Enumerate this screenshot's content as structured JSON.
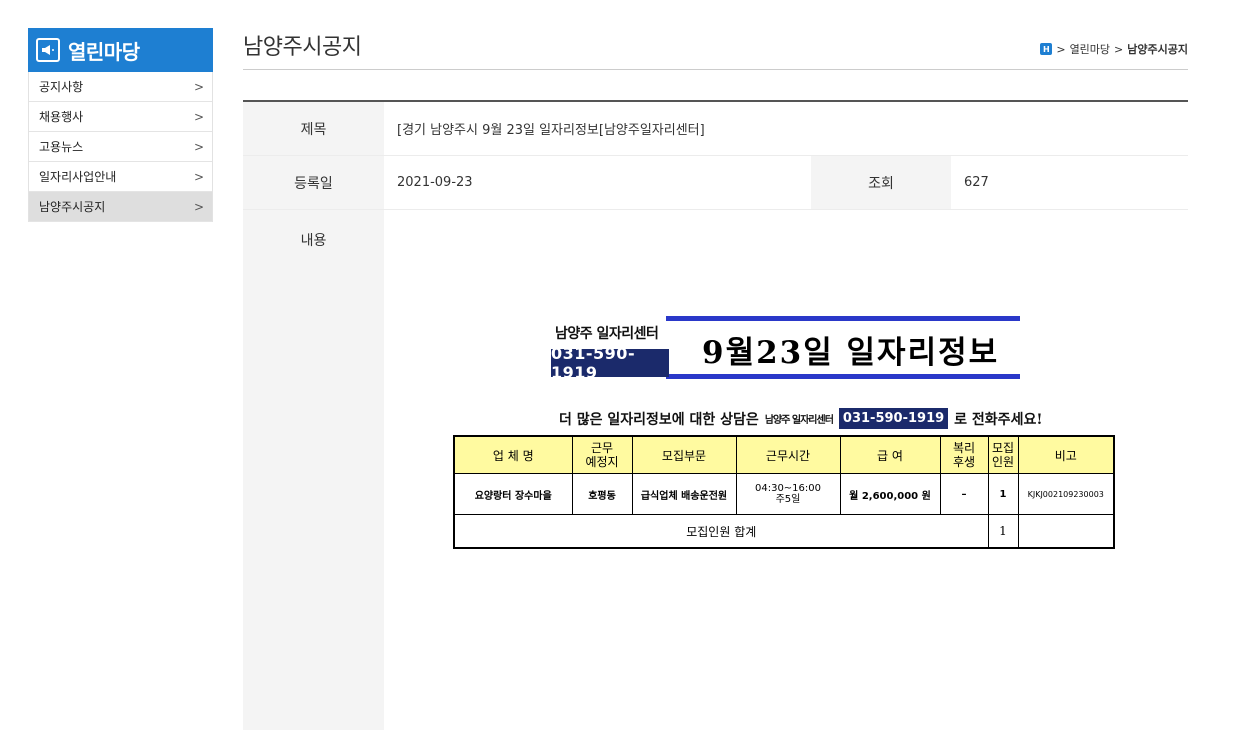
{
  "sidebar": {
    "title": "열린마당",
    "items": [
      {
        "label": "공지사항",
        "active": false
      },
      {
        "label": "채용행사",
        "active": false
      },
      {
        "label": "고용뉴스",
        "active": false
      },
      {
        "label": "일자리사업안내",
        "active": false
      },
      {
        "label": "남양주시공지",
        "active": true
      }
    ]
  },
  "header": {
    "title": "남양주시공지",
    "breadcrumb": [
      "열린마당",
      "남양주시공지"
    ]
  },
  "detail": {
    "subject_label": "제목",
    "subject": "[경기 남양주시 9월 23일 일자리정보[남양주일자리센터]",
    "date_label": "등록일",
    "date": "2021-09-23",
    "views_label": "조회",
    "views": "627",
    "content_label": "내용"
  },
  "poster": {
    "org": "남양주 일자리센터",
    "phone": "031-590-1919",
    "title": "9월23일  일자리정보",
    "cta_prefix": "더 많은 일자리정보에 대한 상담은",
    "cta_org": "남양주 일자리센터",
    "cta_phone": "031-590-1919",
    "cta_suffix": "로 전화주세요!",
    "table": {
      "headers": [
        "업 체 명",
        "근무\n예정지",
        "모집부문",
        "근무시간",
        "급  여",
        "복리\n후생",
        "모집\n인원",
        "비고"
      ],
      "rows": [
        [
          "요양랑터 장수마을",
          "호평동",
          "급식업체 배송운전원",
          "04:30~16:00\n주5일",
          "월 2,600,000 원",
          "–",
          "1",
          "KJKJ002109230003"
        ]
      ],
      "total_label": "모집인원  합계",
      "total_value": "1"
    },
    "colors": {
      "navy": "#1b2a6b",
      "blue_line": "#2a38c9",
      "header_yellow": "#fffaa0"
    }
  },
  "colors": {
    "brand": "#1e7fd2",
    "active_bg": "#dedede"
  }
}
